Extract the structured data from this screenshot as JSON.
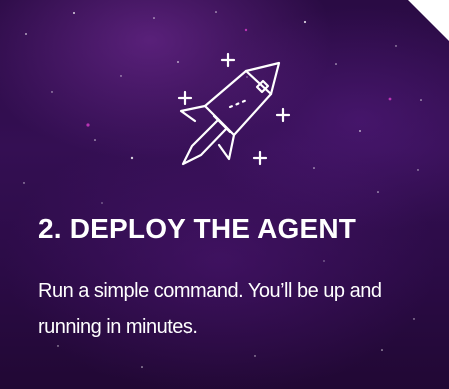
{
  "card": {
    "title": "2. DEPLOY THE AGENT",
    "description": "Run a simple command. You’ll be up and running in minutes.",
    "icon": "rocket-icon",
    "background_color": "#2a0b44",
    "text_color": "#ffffff"
  }
}
